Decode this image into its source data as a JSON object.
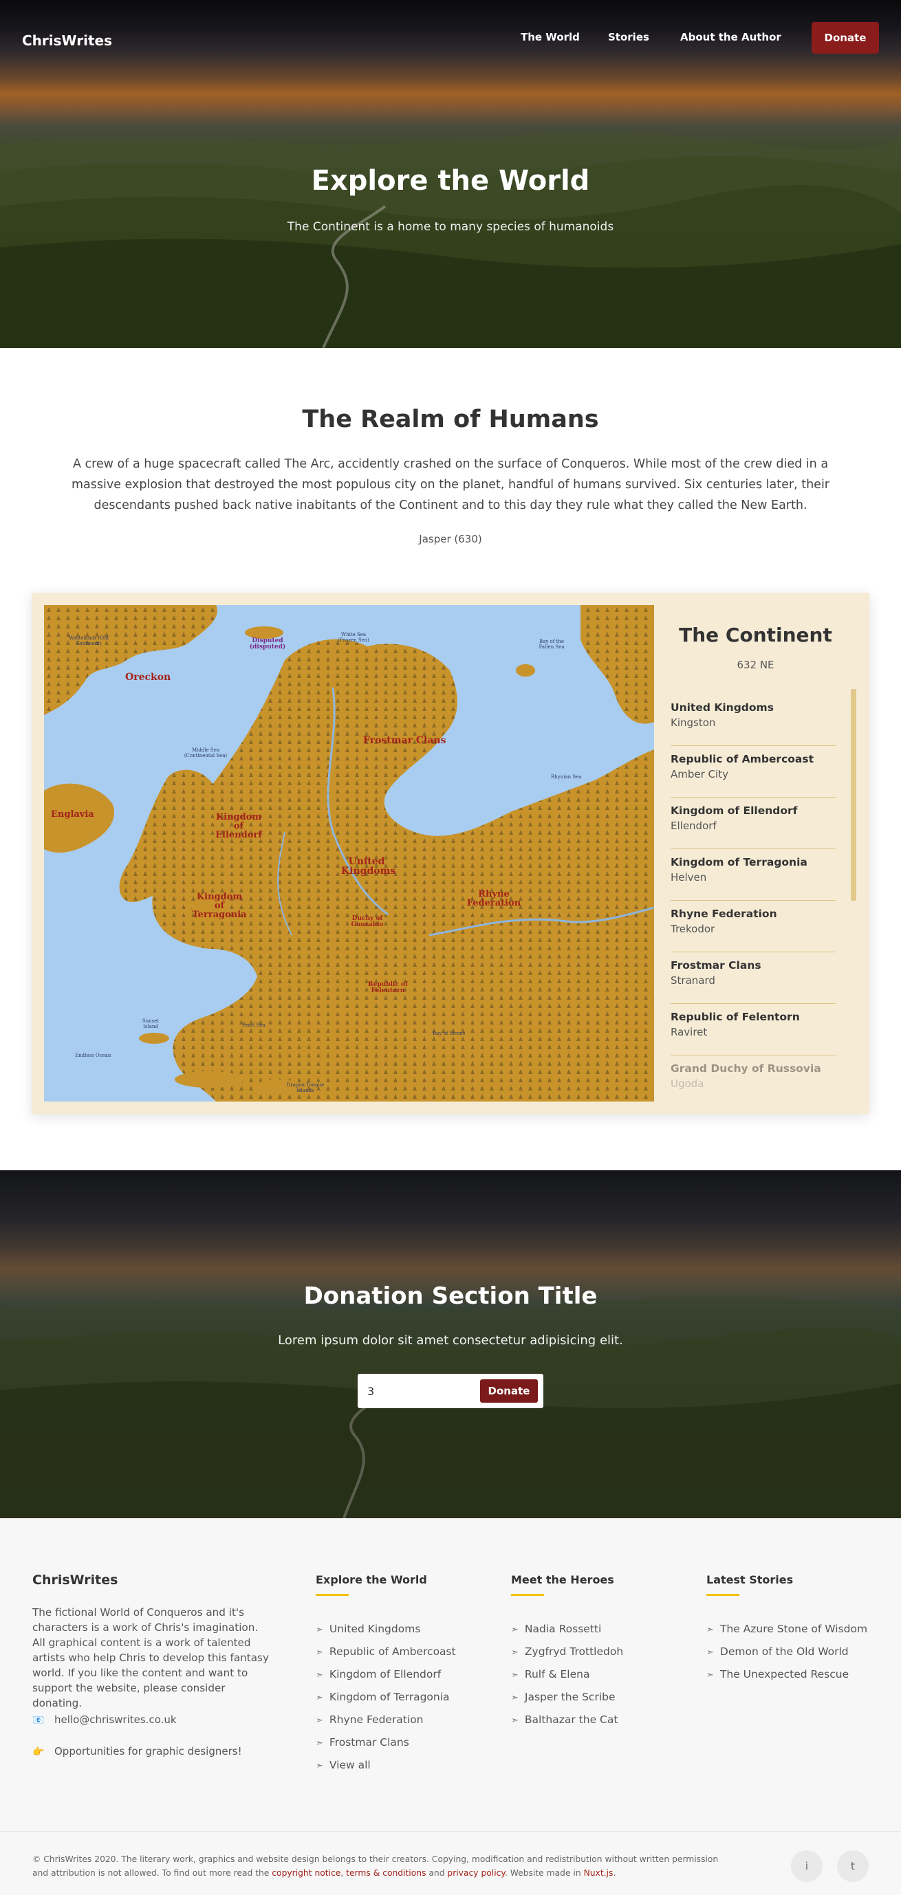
{
  "header": {
    "logo": "ChrisWrites",
    "nav": [
      "The World",
      "Stories",
      "About the Author"
    ],
    "donate_label": "Donate"
  },
  "hero": {
    "title": "Explore the World",
    "subtitle": "The Continent is a home to many species of humanoids"
  },
  "realm": {
    "title": "The Realm of Humans",
    "text": "A crew of a huge spacecraft called The Arc, accidently crashed on the surface of Conqueros. While most of the crew died in a massive explosion that destroyed the most populous city on the planet, handful of humans survived. Six centuries later, their descendants pushed back native inabitants of the Continent and to this day they rule what they called the New Earth.",
    "author": "Jasper (630)"
  },
  "map": {
    "labels": {
      "oreckon": "Oreckon",
      "frostmar": "Frostmar Clans",
      "englavia": "Englavia",
      "ellendorf": "Kingdom of Ellendorf",
      "terragonia": "Kingdom of Terragonia",
      "united": "United Kingdoms",
      "rhyne": "Rhyne Federation",
      "disputed": "Disputed (disputed)",
      "felentorn": "Republic of Felentorn",
      "gonzaldo": "Duchy of Gonzaldo"
    },
    "small_labels": {
      "wastelands": "Wastelands (Old Continent)",
      "middle_sea": "Middle Sea (Continental Sea)",
      "white_sea": "White Sea (Frozen Sea)",
      "bay_fallen": "Bay of the Fallen Sea",
      "rhyne_sea": "Rhynian Sea",
      "pearl_sea": "Pearl Sea",
      "endless_ocean": "Endless Ocean",
      "bay_of_sirens": "Bay of Sirens",
      "dragon_teeth": "Dragon Tongue Islands",
      "sunset_island": "Sunset Island"
    }
  },
  "continent": {
    "title": "The Continent",
    "year": "632 NE",
    "regions": [
      {
        "name": "United Kingdoms",
        "capital": "Kingston"
      },
      {
        "name": "Republic of Ambercoast",
        "capital": "Amber City"
      },
      {
        "name": "Kingdom of Ellendorf",
        "capital": "Ellendorf"
      },
      {
        "name": "Kingdom of Terragonia",
        "capital": "Helven"
      },
      {
        "name": "Rhyne Federation",
        "capital": "Trekodor"
      },
      {
        "name": "Frostmar Clans",
        "capital": "Stranard"
      },
      {
        "name": "Republic of Felentorn",
        "capital": "Raviret"
      },
      {
        "name": "Grand Duchy of Russovia",
        "capital": "Ugoda"
      }
    ]
  },
  "donation": {
    "title": "Donation Section Title",
    "subtitle": "Lorem ipsum dolor sit amet consectetur adipisicing elit.",
    "amount": "3",
    "button": "Donate"
  },
  "footer": {
    "brand": "ChrisWrites",
    "about": "The fictional World of Conqueros and it's characters is a work of Chris's imagination. All graphical content is a work of talented artists who help Chris to develop this fantasy world. If you like the content and want to support the website, please consider donating.",
    "email": "hello@chriswrites.co.uk",
    "opportunities": "Opportunities for graphic designers!",
    "columns": [
      {
        "title": "Explore the World",
        "links": [
          "United Kingdoms",
          "Republic of Ambercoast",
          "Kingdom of Ellendorf",
          "Kingdom of Terragonia",
          "Rhyne Federation",
          "Frostmar Clans",
          "View all"
        ]
      },
      {
        "title": "Meet the Heroes",
        "links": [
          "Nadia Rossetti",
          "Zygfryd Trottledoh",
          "Rulf & Elena",
          "Jasper the Scribe",
          "Balthazar the Cat"
        ]
      },
      {
        "title": "Latest Stories",
        "links": [
          "The Azure Stone of Wisdom",
          "Demon of the Old World",
          "The Unexpected Rescue"
        ]
      }
    ],
    "copyright": {
      "pre": "© ChrisWrites 2020. The literary work, graphics and website design belongs to their creators. Copying, modification and redistribution without written permission and attribution is not allowed. To find out more read the ",
      "link1": "copyright notice",
      "sep1": ", ",
      "link2": "terms & conditions",
      "sep2": " and ",
      "link3": "privacy policy",
      "mid": ". Website made in ",
      "link4": "Nuxt.js",
      "end": "."
    },
    "social": [
      "i",
      "t"
    ]
  },
  "colors": {
    "accent_red": "#8b1c1c",
    "footer_underline": "#f2c200",
    "map_land": "#c9932b",
    "map_sea": "#a9cdf0",
    "panel_bg": "#f6ecd6"
  }
}
